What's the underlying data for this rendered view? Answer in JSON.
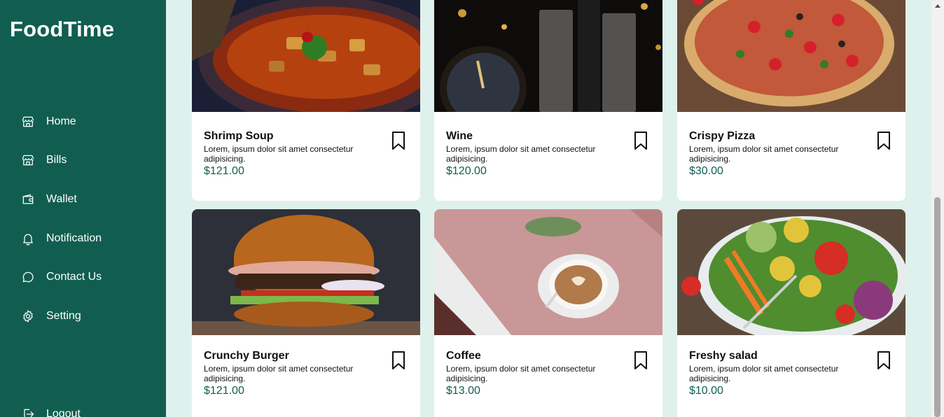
{
  "app": {
    "brand": "FoodTime"
  },
  "sidebar": {
    "items": [
      {
        "label": "Home",
        "icon": "store-icon"
      },
      {
        "label": "Bills",
        "icon": "store-icon"
      },
      {
        "label": "Wallet",
        "icon": "wallet-icon"
      },
      {
        "label": "Notification",
        "icon": "bell-icon"
      },
      {
        "label": "Contact Us",
        "icon": "chat-bubble-icon"
      },
      {
        "label": "Setting",
        "icon": "gear-icon"
      },
      {
        "label": "Logout",
        "icon": "logout-icon"
      }
    ]
  },
  "products": [
    {
      "name": "Shrimp Soup",
      "description": "Lorem, ipsum dolor sit amet consectetur adipisicing.",
      "price": "$121.00"
    },
    {
      "name": "Wine",
      "description": "Lorem, ipsum dolor sit amet consectetur adipisicing.",
      "price": "$120.00"
    },
    {
      "name": "Crispy Pizza",
      "description": "Lorem, ipsum dolor sit amet consectetur adipisicing.",
      "price": "$30.00"
    },
    {
      "name": "Crunchy Burger",
      "description": "Lorem, ipsum dolor sit amet consectetur adipisicing.",
      "price": "$121.00"
    },
    {
      "name": "Coffee",
      "description": "Lorem, ipsum dolor sit amet consectetur adipisicing.",
      "price": "$13.00"
    },
    {
      "name": "Freshy salad",
      "description": "Lorem, ipsum dolor sit amet consectetur adipisicing.",
      "price": "$10.00"
    }
  ],
  "colors": {
    "sidebar": "#115e50",
    "page_background": "#dff1ec",
    "price": "#115e50"
  }
}
